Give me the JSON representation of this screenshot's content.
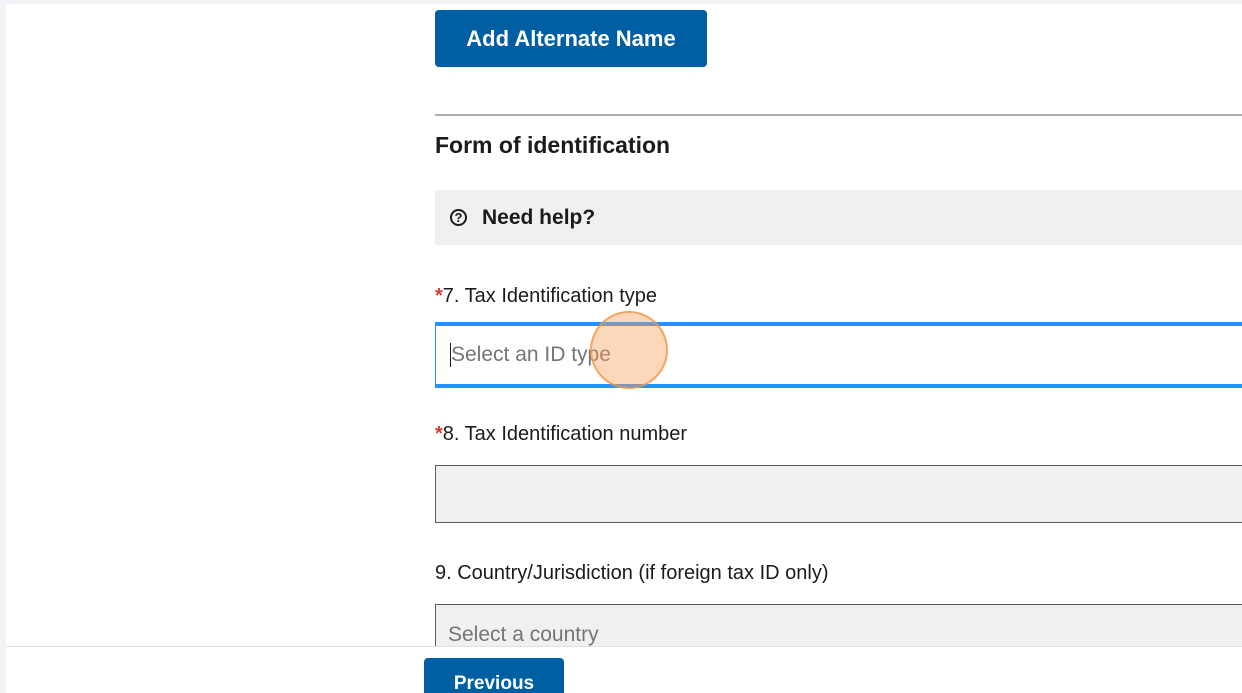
{
  "form": {
    "add_alternate_name_button": "Add Alternate Name",
    "section_title": "Form of identification",
    "help": {
      "icon": "question-circle-icon",
      "label": "Need help?"
    },
    "required_marker": "*",
    "fields": {
      "tax_id_type": {
        "label": "7. Tax Identification type",
        "placeholder": "Select an ID type",
        "required": true
      },
      "tax_id_number": {
        "label": "8. Tax Identification number",
        "value": "",
        "required": true
      },
      "country": {
        "label": "9. Country/Jurisdiction (if foreign tax ID only)",
        "placeholder": "Select a country",
        "required": false
      }
    }
  },
  "footer": {
    "previous_button": "Previous"
  },
  "colors": {
    "primary": "#005ea2",
    "focus": "#2491ff",
    "required": "#d83933",
    "click_indicator": "#f7a05a"
  }
}
